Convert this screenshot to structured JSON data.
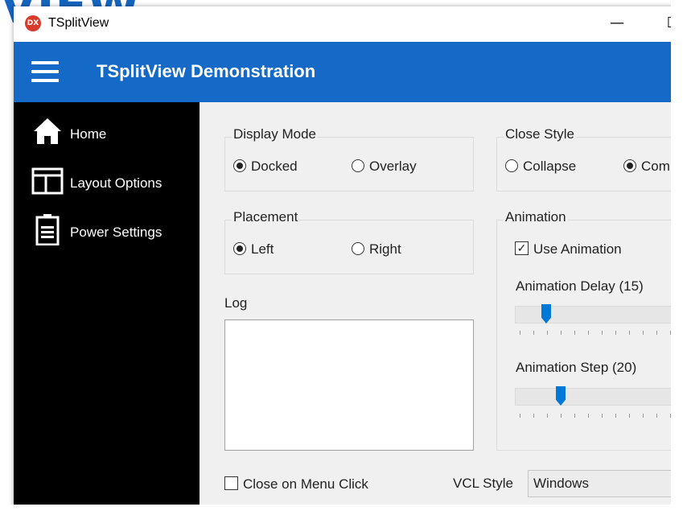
{
  "background_text": "VIEW",
  "window": {
    "app_icon": "DX",
    "title": "TSplitView",
    "minimize": "—",
    "maximize": "☐"
  },
  "header": {
    "title": "TSplitView Demonstration"
  },
  "sidebar": {
    "items": [
      {
        "label": "Home",
        "icon": "home-icon"
      },
      {
        "label": "Layout Options",
        "icon": "layout-icon"
      },
      {
        "label": "Power Settings",
        "icon": "battery-icon"
      }
    ]
  },
  "display_mode": {
    "label": "Display Mode",
    "options": [
      "Docked",
      "Overlay"
    ],
    "selected": "Docked"
  },
  "close_style": {
    "label": "Close Style",
    "options": [
      "Collapse",
      "Com"
    ],
    "selected": "Com"
  },
  "placement": {
    "label": "Placement",
    "options": [
      "Left",
      "Right"
    ],
    "selected": "Left"
  },
  "animation": {
    "label": "Animation",
    "use_animation_label": "Use Animation",
    "use_animation": true,
    "delay_label": "Animation Delay (15)",
    "delay_value": 15,
    "step_label": "Animation Step (20)",
    "step_value": 20
  },
  "log": {
    "label": "Log"
  },
  "footer": {
    "close_on_menu_click_label": "Close on Menu Click",
    "close_on_menu_click": false,
    "vcl_style_label": "VCL Style",
    "vcl_style_value": "Windows"
  },
  "colors": {
    "header": "#1569c7",
    "sidebar": "#000000",
    "accent": "#0078d7"
  }
}
